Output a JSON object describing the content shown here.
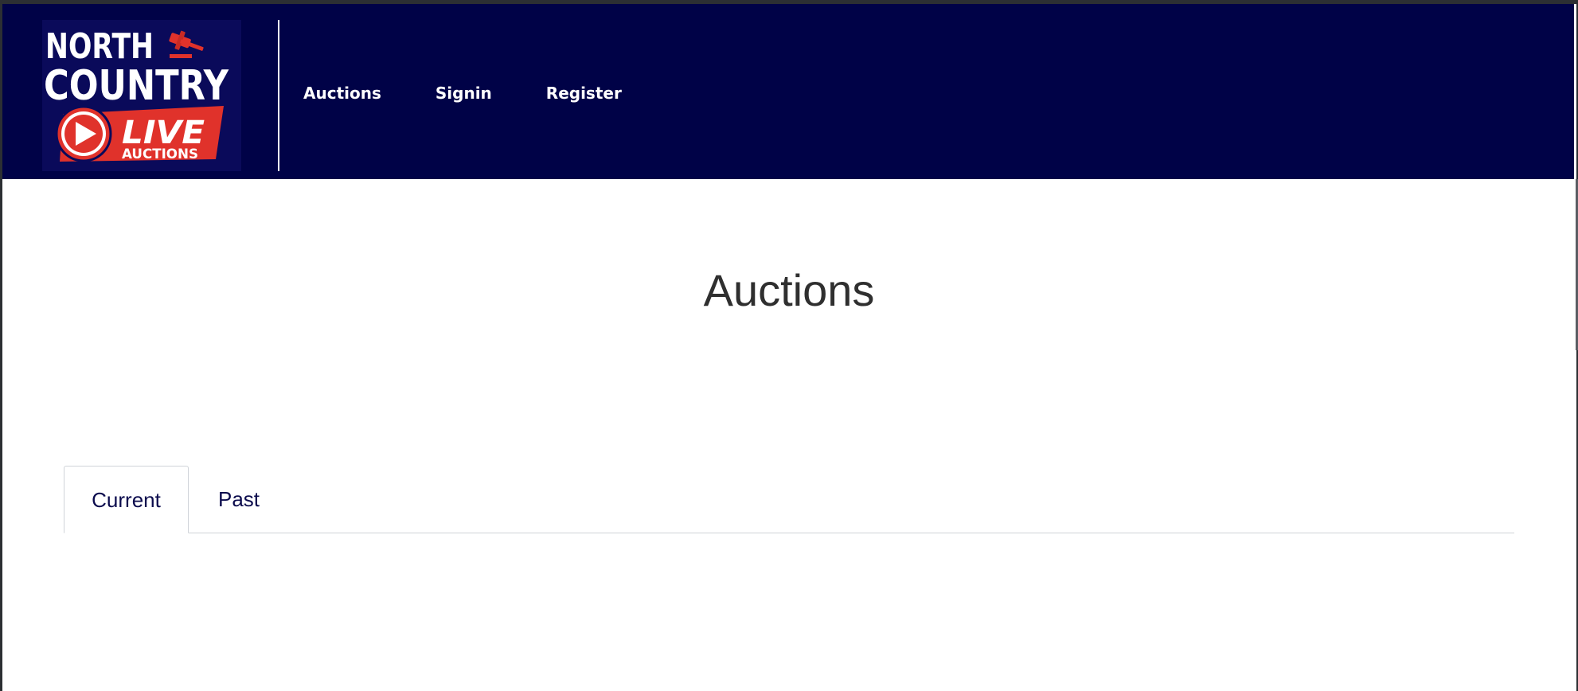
{
  "brand": {
    "logo_line1": "NORTH",
    "logo_line2": "COUNTRY",
    "logo_line3": "LIVE",
    "logo_line4": "AUCTIONS",
    "navbar_color": "#000247",
    "accent_color": "#e0322b"
  },
  "nav": {
    "items": [
      {
        "label": "Auctions"
      },
      {
        "label": "Signin"
      },
      {
        "label": "Register"
      }
    ]
  },
  "main": {
    "title": "Auctions",
    "tabs": [
      {
        "label": "Current",
        "active": true
      },
      {
        "label": "Past",
        "active": false
      }
    ]
  }
}
